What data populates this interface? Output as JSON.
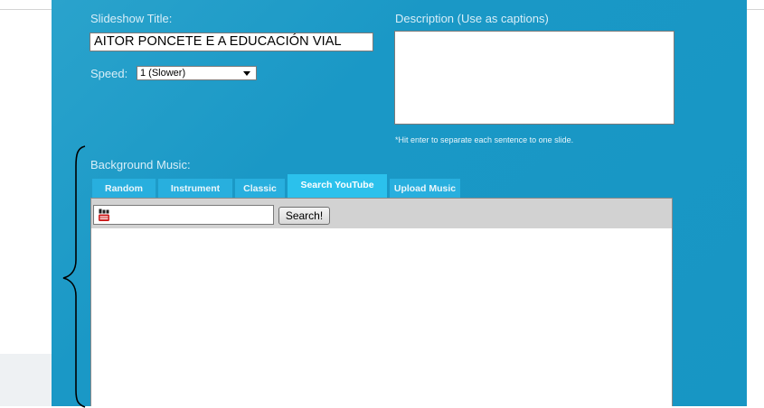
{
  "form": {
    "slideshow_title_label": "Slideshow Title:",
    "slideshow_title_value": "AITOR PONCETE E A EDUCACIÓN VIAL",
    "speed_label": "Speed:",
    "speed_value": "1 (Slower)",
    "description_label": "Description (Use as captions)",
    "description_value": "",
    "description_hint": "*Hit enter to separate each sentence to one slide."
  },
  "music": {
    "label": "Background Music:",
    "tabs": [
      {
        "label": "Random",
        "active": false
      },
      {
        "label": "Instrument",
        "active": false
      },
      {
        "label": "Classic",
        "active": false
      },
      {
        "label": "Search YouTube",
        "active": true
      },
      {
        "label": "Upload Music",
        "active": false
      }
    ],
    "search_value": "",
    "search_button_label": "Search!",
    "youtube_icon": "youtube-icon"
  },
  "colors": {
    "panel_blue": "#1796c4",
    "active_tab": "#2bc1ec",
    "inactive_tab": "#28afde",
    "youtube_red": "#cc1f1f"
  }
}
